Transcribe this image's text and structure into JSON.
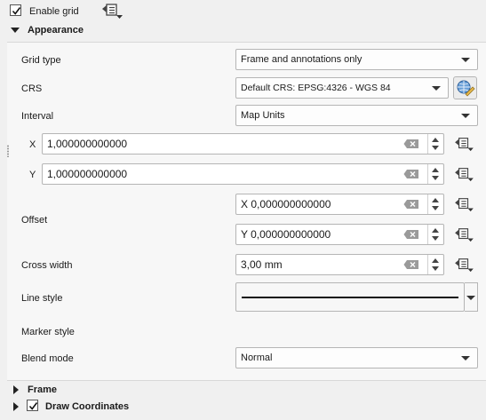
{
  "enable_grid": {
    "label": "Enable grid",
    "checked": true
  },
  "appearance": {
    "title": "Appearance",
    "grid_type": {
      "label": "Grid type",
      "value": "Frame and annotations only"
    },
    "crs": {
      "label": "CRS",
      "value": "Default CRS: EPSG:4326 - WGS 84"
    },
    "interval": {
      "label": "Interval",
      "value": "Map Units",
      "x_label": "X",
      "x_value": "1,000000000000",
      "y_label": "Y",
      "y_value": "1,000000000000"
    },
    "offset": {
      "label": "Offset",
      "x_value": "X 0,000000000000",
      "y_value": "Y 0,000000000000"
    },
    "cross_width": {
      "label": "Cross width",
      "value": "3,00 mm"
    },
    "line_style": {
      "label": "Line style"
    },
    "marker_style": {
      "label": "Marker style"
    },
    "blend_mode": {
      "label": "Blend mode",
      "value": "Normal"
    }
  },
  "frame": {
    "title": "Frame"
  },
  "draw_coordinates": {
    "label": "Draw Coordinates",
    "checked": true
  },
  "colors": {
    "panel_bg": "#f7f7f7",
    "field_border": "#b5b5b5",
    "page_bg": "#f0f0f0"
  },
  "icons": [
    "checkmark-icon",
    "data-defined-override-icon",
    "crs-selector-icon",
    "clear-icon",
    "spin-up-icon",
    "spin-down-icon",
    "expand-arrow-icon",
    "collapse-arrow-icon"
  ]
}
